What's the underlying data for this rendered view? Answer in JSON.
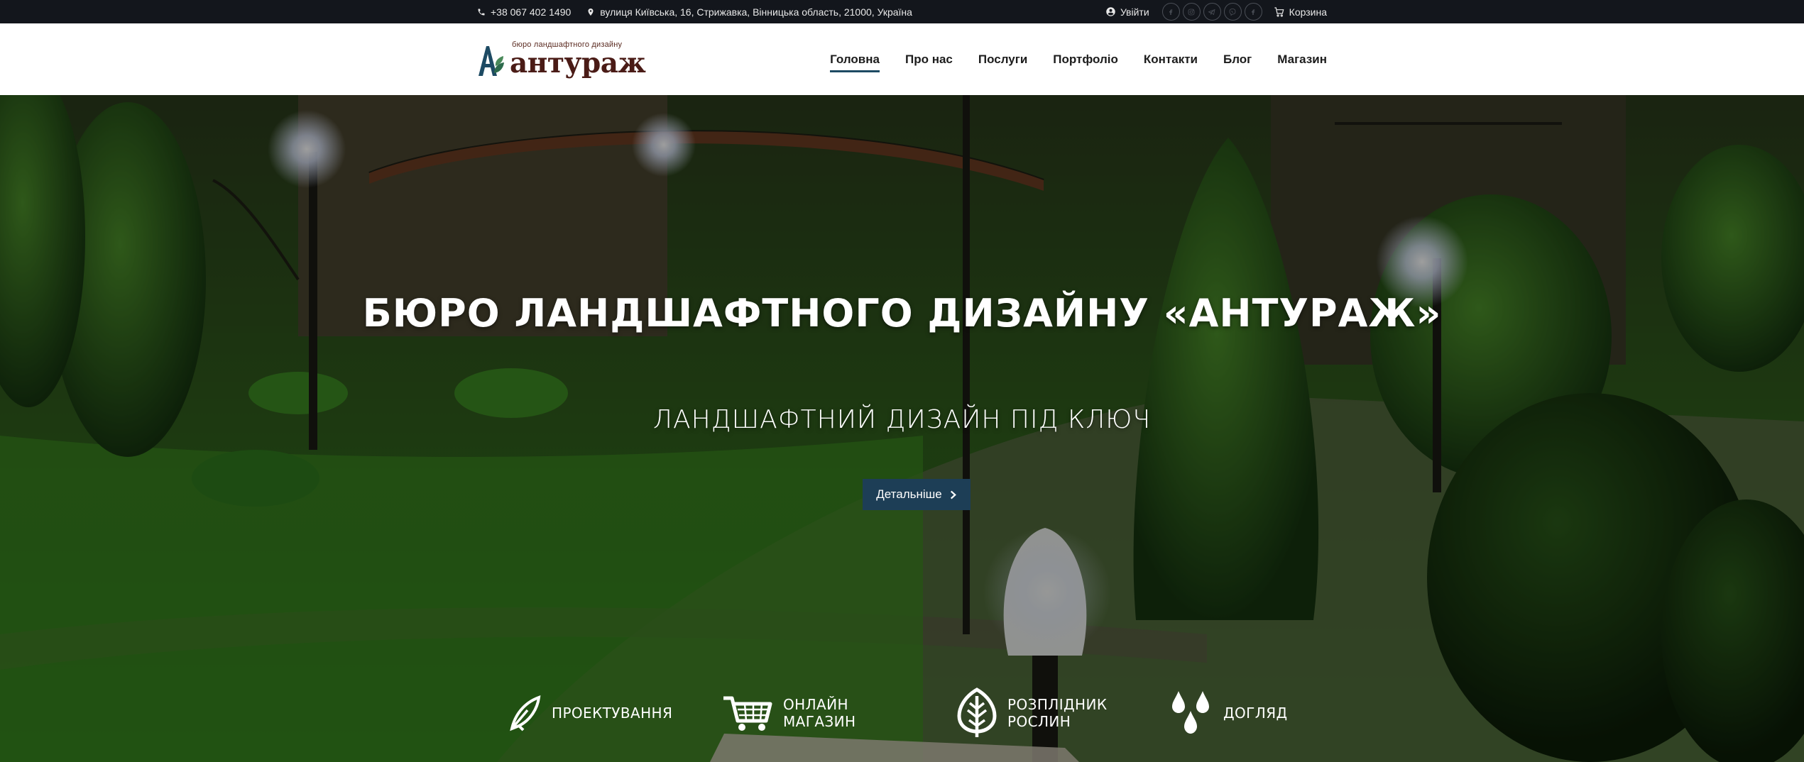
{
  "topbar": {
    "phone": "+38 067 402 1490",
    "address": "вулиця Київська, 16, Стрижавка, Вінницька область, 21000, Україна",
    "login": "Увійти",
    "cart": "Корзина",
    "socials": [
      "facebook-icon",
      "instagram-icon",
      "telegram-icon",
      "viber-icon",
      "facebook-icon"
    ]
  },
  "logo": {
    "subtitle": "бюро ландшафтного дизайну",
    "name": "антураж"
  },
  "nav": {
    "items": [
      "Головна",
      "Про нас",
      "Послуги",
      "Портфоліо",
      "Контакти",
      "Блог",
      "Магазин"
    ],
    "active": "Головна"
  },
  "hero": {
    "title": "БЮРО ЛАНДШАФТНОГО ДИЗАЙНУ «АНТУРАЖ»",
    "subtitle": "ЛАНДШАФТНИЙ ДИЗАЙН ПІД КЛЮЧ",
    "button": "Детальніше"
  },
  "features": [
    {
      "line1": "ПРОЕКТУВАННЯ",
      "line2": "",
      "icon": "pen-leaf-icon"
    },
    {
      "line1": "ОНЛАЙН",
      "line2": "МАГАЗИН",
      "icon": "cart-icon"
    },
    {
      "line1": "РОЗПЛІДНИК",
      "line2": "РОСЛИН",
      "icon": "leaf-icon"
    },
    {
      "line1": "ДОГЛЯД",
      "line2": "",
      "icon": "water-drops-icon"
    }
  ],
  "colors": {
    "topbar_bg": "#13161c",
    "accent": "#1d3e56",
    "logo_brown": "#4a1b16",
    "logo_teal": "#1d4a63"
  }
}
